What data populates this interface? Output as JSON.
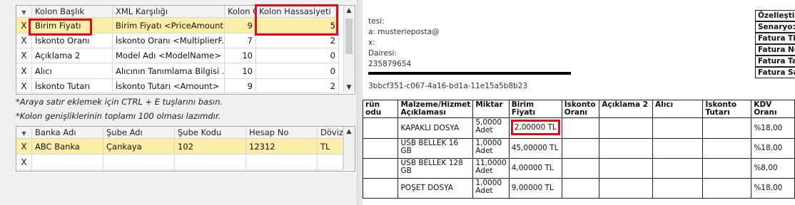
{
  "kolon_grid": {
    "headers": [
      "Kolon Başlık",
      "XML Karşılığı",
      "Kolon G",
      "Kolon Hassasiyeti"
    ],
    "rows": [
      {
        "x": "X",
        "baslik": "Birim Fiyatı",
        "xml": "Birim Fiyatı <PriceAmount>",
        "genislik": "9",
        "hassasiyet": "5"
      },
      {
        "x": "X",
        "baslik": "İskonto Oranı",
        "xml": "İskonto Oranı <MultiplierF...",
        "genislik": "7",
        "hassasiyet": "2"
      },
      {
        "x": "X",
        "baslik": "Açıklama 2",
        "xml": "Model Adı <ModelName>",
        "genislik": "10",
        "hassasiyet": "0"
      },
      {
        "x": "X",
        "baslik": "Alıcı",
        "xml": "Alıcının Tanımlama Bilgisi ...",
        "genislik": "10",
        "hassasiyet": "0"
      },
      {
        "x": "X",
        "baslik": "İskonto Tutarı",
        "xml": "İskonto Tutarı <Amount>",
        "genislik": "9",
        "hassasiyet": "2"
      }
    ]
  },
  "notes": {
    "line1": "*Araya satır eklemek için CTRL + E tuşlarını basın.",
    "line2": "*Kolon genişliklerinin toplamı 100 olması lazımdır."
  },
  "banka_grid": {
    "headers": [
      "Banka Adı",
      "Şube Adı",
      "Şube Kodu",
      "Hesap No",
      "Döviz"
    ],
    "rows": [
      {
        "x": "X",
        "banka": "ABC Banka",
        "sube": "Çankaya",
        "kod": "102",
        "hesap": "12312",
        "doviz": "TL"
      },
      {
        "x": "X",
        "banka": "",
        "sube": "",
        "kod": "",
        "hesap": "",
        "doviz": ""
      }
    ]
  },
  "invoice": {
    "info_lines": [
      "tesi:",
      "a: musterieposta@",
      "x:",
      "Dairesi:",
      "235879654"
    ],
    "ettn": "3bbcf351-c067-4a16-bd1a-11e15a5b8b23",
    "right_labels": [
      "Özelleştir",
      "Senaryo:",
      "Fatura Tip",
      "Fatura No",
      "Fatura Ta",
      "Fatura Sa"
    ],
    "headers": [
      "rün\nodu",
      "Malzeme/Hizmet\nAçıklaması",
      "Miktar",
      "Birim Fiyatı",
      "İskonto\nOranı",
      "Açıklama 2",
      "Alıcı",
      "İskonto\nTutarı",
      "KDV\nOranı"
    ],
    "rows": [
      {
        "malzeme": "KAPAKLI DOSYA",
        "miktar": "5,0000\nAdet",
        "fiyat": "2,00000 TL",
        "kdv": "%18,00"
      },
      {
        "malzeme": "USB BELLEK 16\nGB",
        "miktar": "1,0000\nAdet",
        "fiyat": "45,00000 TL",
        "kdv": "%18,00"
      },
      {
        "malzeme": "USB BELLEK 128\nGB",
        "miktar": "11,0000\nAdet",
        "fiyat": "4,00000 TL",
        "kdv": "%8,00"
      },
      {
        "malzeme": "POŞET DOSYA",
        "miktar": "1,0000\nAdet",
        "fiyat": "9,00000 TL",
        "kdv": "%18,00"
      }
    ]
  },
  "colors": {
    "highlight": "#fcefa7",
    "annotation_red": "#e10c18"
  }
}
